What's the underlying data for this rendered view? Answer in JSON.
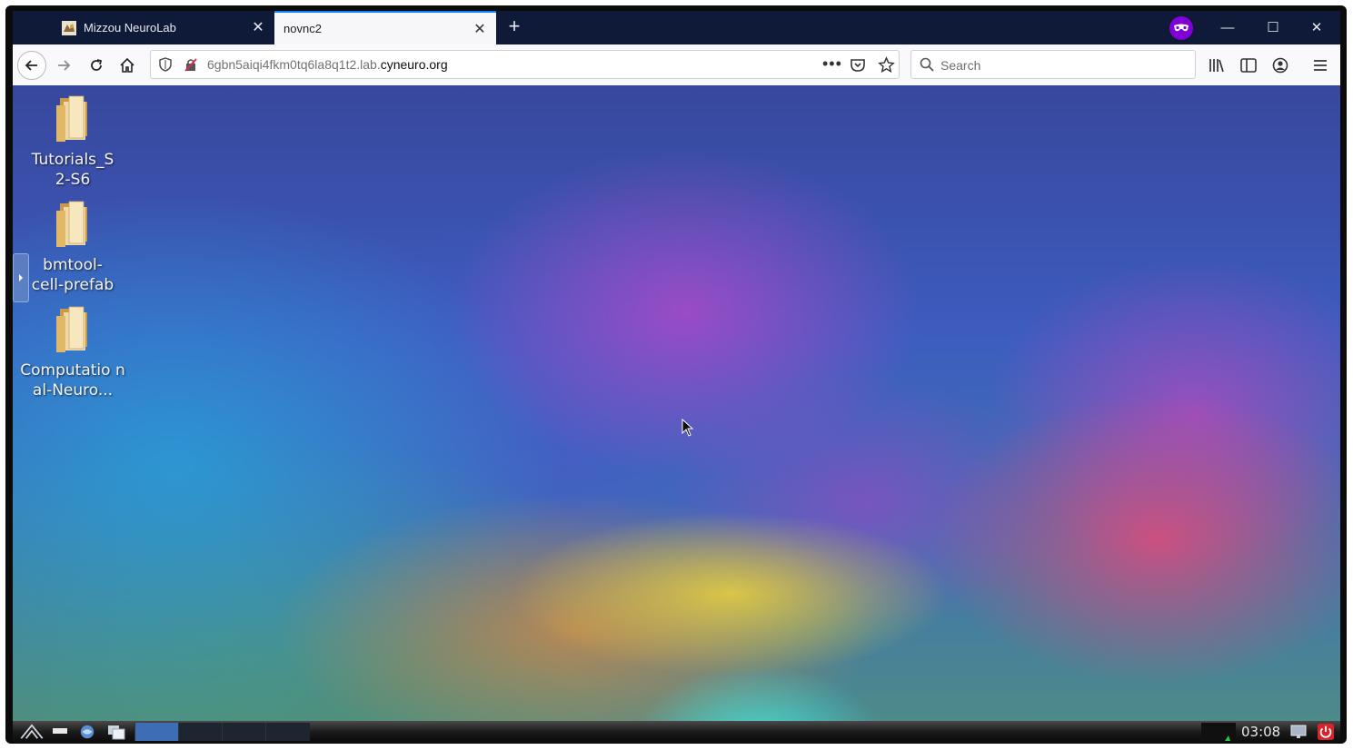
{
  "browser": {
    "tabs": [
      {
        "label": "Mizzou NeuroLab",
        "active": false
      },
      {
        "label": "novnc2",
        "active": true
      }
    ],
    "new_tab_icon": "plus-icon",
    "private_icon": "private-browsing-mask-icon",
    "window_controls": [
      "minimize-icon",
      "maximize-icon",
      "close-icon"
    ],
    "accent_color": "#0a84ff",
    "private_color": "#8000d7"
  },
  "navbar": {
    "url_prefix": "6gbn5aiqi4fkm0tq6la8q1t2.lab.",
    "url_domain": "cyneuro.org",
    "search_placeholder": "Search"
  },
  "desktop": {
    "icons": [
      {
        "label": "Tutorials_S 2-S6",
        "icon": "folder-icon"
      },
      {
        "label": "bmtool- cell-prefab",
        "icon": "folder-icon"
      },
      {
        "label": "Computatio nal-Neuro...",
        "icon": "folder-icon"
      }
    ]
  },
  "taskbar": {
    "clock": "03:08"
  }
}
